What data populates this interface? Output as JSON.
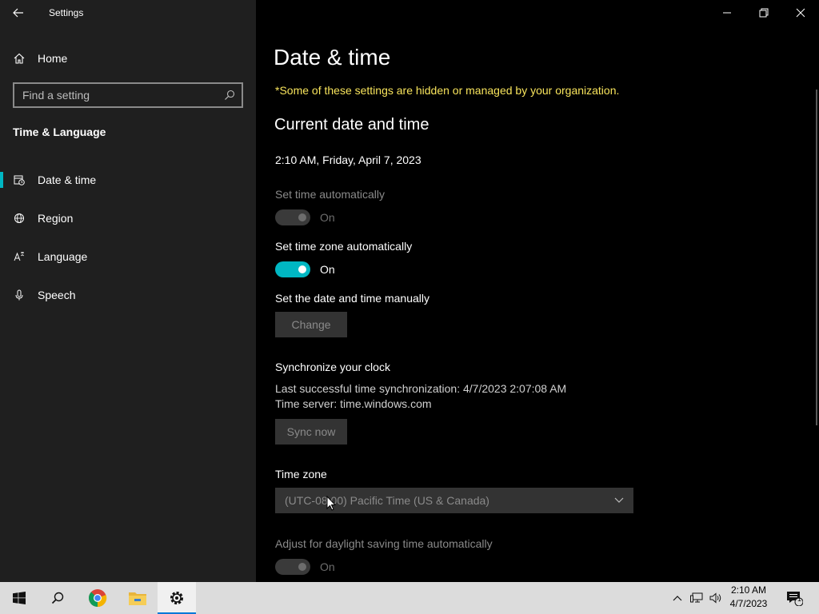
{
  "window": {
    "title": "Settings"
  },
  "sidebar": {
    "home_label": "Home",
    "search_placeholder": "Find a setting",
    "section_title": "Time & Language",
    "items": [
      {
        "label": "Date & time",
        "icon": "calendar-clock-icon",
        "active": true
      },
      {
        "label": "Region",
        "icon": "globe-icon",
        "active": false
      },
      {
        "label": "Language",
        "icon": "language-icon",
        "active": false
      },
      {
        "label": "Speech",
        "icon": "microphone-icon",
        "active": false
      }
    ]
  },
  "main": {
    "title": "Date & time",
    "org_note": "*Some of these settings are hidden or managed by your organization.",
    "current_heading": "Current date and time",
    "current_datetime": "2:10 AM, Friday, April 7, 2023",
    "set_time_auto": {
      "label": "Set time automatically",
      "state": "On",
      "enabled": false
    },
    "set_tz_auto": {
      "label": "Set time zone automatically",
      "state": "On",
      "enabled": true
    },
    "manual": {
      "label": "Set the date and time manually",
      "button": "Change"
    },
    "sync": {
      "heading": "Synchronize your clock",
      "last_sync": "Last successful time synchronization: 4/7/2023 2:07:08 AM",
      "server": "Time server: time.windows.com",
      "button": "Sync now"
    },
    "timezone": {
      "label": "Time zone",
      "value": "(UTC-08:00) Pacific Time (US & Canada)"
    },
    "dst": {
      "label": "Adjust for daylight saving time automatically",
      "state": "On",
      "enabled": false
    }
  },
  "taskbar": {
    "time": "2:10 AM",
    "date": "4/7/2023",
    "notification_count": "1"
  },
  "colors": {
    "accent": "#00b7c3",
    "warning": "#f8e45c",
    "sidebar_bg": "#1f1f1f",
    "main_bg": "#000000"
  }
}
